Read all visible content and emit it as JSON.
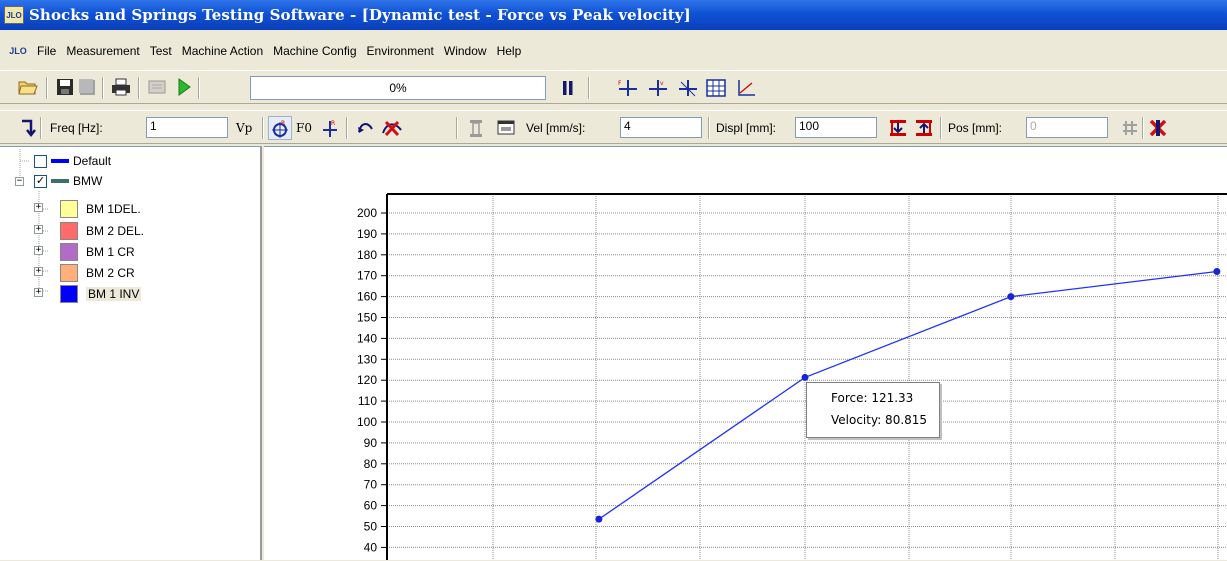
{
  "window": {
    "title": "Shocks and Springs Testing Software - [Dynamic test - Force vs Peak velocity]",
    "icon_text": "JLO"
  },
  "menu": {
    "icon_text": "JLO",
    "items": [
      "File",
      "Measurement",
      "Test",
      "Machine Action",
      "Machine Config",
      "Environment",
      "Window",
      "Help"
    ]
  },
  "toolbar1": {
    "progress": "0%"
  },
  "toolbar2": {
    "freq_label": "Freq [Hz]:",
    "freq_value": "1",
    "vp_label": "Vp",
    "f0_label": "F0",
    "vel_label": "Vel [mm/s]:",
    "vel_value": "4",
    "displ_label": "Displ [mm]:",
    "displ_value": "100",
    "pos_label": "Pos [mm]:",
    "pos_value": "0"
  },
  "tree": {
    "default_label": "Default",
    "bmw_label": "BMW",
    "children": [
      {
        "label": "BM 1DEL.",
        "color": "#FFFF99"
      },
      {
        "label": "BM 2 DEL.",
        "color": "#FF6B6B"
      },
      {
        "label": "BM 1 CR",
        "color": "#B36BC8"
      },
      {
        "label": "BM 2 CR",
        "color": "#FFB07A"
      },
      {
        "label": "BM 1 INV",
        "color": "#0000FF"
      }
    ],
    "colors": {
      "default_line": "#0000FF",
      "bmw_line": "#3C6E6E"
    }
  },
  "chart_data": {
    "type": "line",
    "ylim": [
      40,
      200
    ],
    "yticks": [
      "200",
      "190",
      "180",
      "170",
      "160",
      "150",
      "140",
      "130",
      "120",
      "110",
      "100",
      "90",
      "80",
      "70",
      "60",
      "50",
      "40"
    ],
    "grid": true,
    "series": [
      {
        "color": "#1F32FF",
        "x": [
          55.3,
          80.815,
          106.3,
          131.8
        ],
        "y": [
          53.5,
          121.33,
          160,
          172
        ]
      }
    ],
    "tooltip": {
      "force": "Force: 121.33",
      "velocity": "Velocity: 80.815"
    }
  }
}
